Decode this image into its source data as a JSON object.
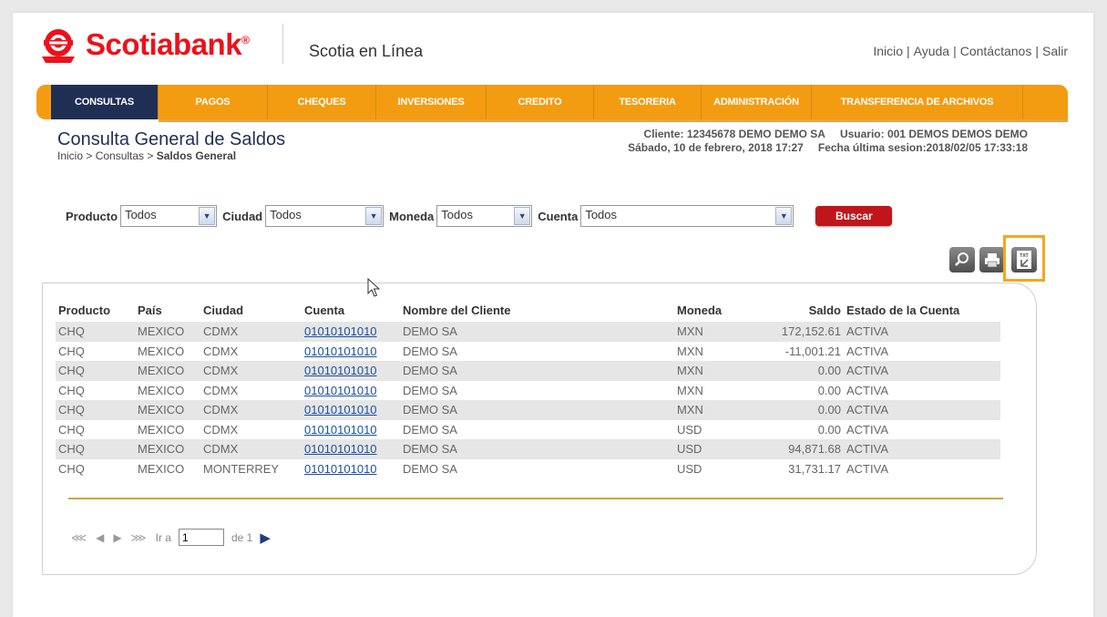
{
  "brand": {
    "name": "Scotiabank",
    "registered": "®",
    "app_name": "Scotia en Línea",
    "accent": "#ec111a"
  },
  "top_links": [
    "Inicio",
    "Ayuda",
    "Contáctanos",
    "Salir"
  ],
  "nav": {
    "color": "#f39c12",
    "active_color": "#1f2f54",
    "items": [
      "CONSULTAS",
      "PAGOS",
      "CHEQUES",
      "INVERSIONES",
      "CREDITO",
      "TESORERIA",
      "ADMINISTRACIÓN",
      "TRANSFERENCIA DE ARCHIVOS"
    ]
  },
  "page": {
    "title": "Consulta General de Saldos",
    "breadcrumb_prefix": "Inicio > Consultas > ",
    "breadcrumb_current": "Saldos General"
  },
  "client_info": {
    "cliente": "Cliente: 12345678 DEMO DEMO SA",
    "usuario": "Usuario: 001 DEMOS DEMOS DEMO",
    "fecha": "Sábado, 10 de febrero, 2018 17:27",
    "ultima_sesion": "Fecha última sesion:2018/02/05 17:33:18"
  },
  "filters": {
    "producto": {
      "label": "Producto",
      "value": "Todos"
    },
    "ciudad": {
      "label": "Ciudad",
      "value": "Todos"
    },
    "moneda": {
      "label": "Moneda",
      "value": "Todos"
    },
    "cuenta": {
      "label": "Cuenta",
      "value": "Todos"
    },
    "search_button": "Buscar"
  },
  "actions": {
    "export_icon_text": "TXT"
  },
  "table": {
    "headers": [
      "Producto",
      "País",
      "Ciudad",
      "Cuenta",
      "Nombre del Cliente",
      "Moneda",
      "Saldo",
      "Estado de la Cuenta"
    ],
    "rows": [
      [
        "CHQ",
        "MEXICO",
        "CDMX",
        "01010101010",
        "DEMO SA",
        "MXN",
        "172,152.61",
        "ACTIVA"
      ],
      [
        "CHQ",
        "MEXICO",
        "CDMX",
        "01010101010",
        "DEMO SA",
        "MXN",
        "-11,001.21",
        "ACTIVA"
      ],
      [
        "CHQ",
        "MEXICO",
        "CDMX",
        "01010101010",
        "DEMO SA",
        "MXN",
        "0.00",
        "ACTIVA"
      ],
      [
        "CHQ",
        "MEXICO",
        "CDMX",
        "01010101010",
        "DEMO SA",
        "MXN",
        "0.00",
        "ACTIVA"
      ],
      [
        "CHQ",
        "MEXICO",
        "CDMX",
        "01010101010",
        "DEMO SA",
        "MXN",
        "0.00",
        "ACTIVA"
      ],
      [
        "CHQ",
        "MEXICO",
        "CDMX",
        "01010101010",
        "DEMO SA",
        "USD",
        "0.00",
        "ACTIVA"
      ],
      [
        "CHQ",
        "MEXICO",
        "CDMX",
        "01010101010",
        "DEMO SA",
        "USD",
        "94,871.68",
        "ACTIVA"
      ],
      [
        "CHQ",
        "MEXICO",
        "MONTERREY",
        "01010101010",
        "DEMO SA",
        "USD",
        "31,731.17",
        "ACTIVA"
      ]
    ]
  },
  "pager": {
    "go_label": "Ir a",
    "page_value": "1",
    "of_label": "de 1"
  }
}
